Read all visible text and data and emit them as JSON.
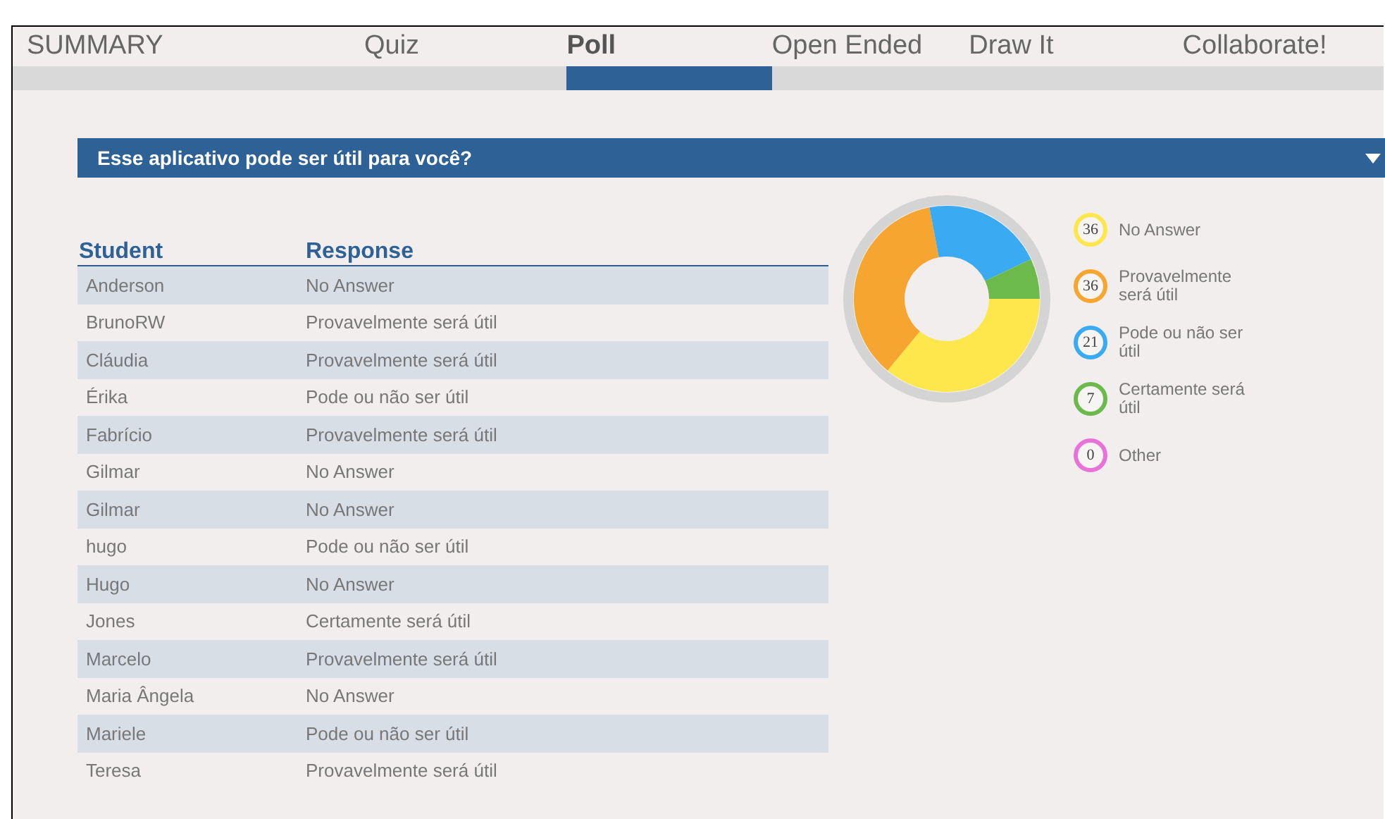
{
  "tabs": [
    {
      "label": "SUMMARY",
      "selected": false
    },
    {
      "label": "Quiz",
      "selected": false
    },
    {
      "label": "Poll",
      "selected": true
    },
    {
      "label": "Open Ended",
      "selected": false
    },
    {
      "label": "Draw It",
      "selected": false
    },
    {
      "label": "Collaborate!",
      "selected": false
    }
  ],
  "question": {
    "title": "Esse aplicativo pode ser útil para você?",
    "expanded": true
  },
  "table": {
    "columns": [
      "Student",
      "Response"
    ],
    "rows": [
      [
        "Anderson",
        "No Answer"
      ],
      [
        "BrunoRW",
        "Provavelmente será útil"
      ],
      [
        "Cláudia",
        "Provavelmente será útil"
      ],
      [
        "Érika",
        "Pode ou não ser útil"
      ],
      [
        "Fabrício",
        "Provavelmente será útil"
      ],
      [
        "Gilmar",
        "No Answer"
      ],
      [
        "Gilmar",
        "No Answer"
      ],
      [
        "hugo",
        "Pode ou não ser útil"
      ],
      [
        "Hugo",
        "No Answer"
      ],
      [
        "Jones",
        "Certamente será útil"
      ],
      [
        "Marcelo",
        "Provavelmente será útil"
      ],
      [
        "Maria Ângela",
        "No Answer"
      ],
      [
        "Mariele",
        "Pode ou não ser útil"
      ],
      [
        "Teresa",
        "Provavelmente será útil"
      ]
    ]
  },
  "chart_data": {
    "type": "donut",
    "categories": [
      "No Answer",
      "Provavelmente será útil",
      "Pode ou não ser útil",
      "Certamente será útil",
      "Other"
    ],
    "values": [
      36,
      36,
      21,
      7,
      0
    ]
  },
  "legend": [
    {
      "count": "36",
      "color": "#fde74c"
    },
    {
      "count": "36",
      "color": "#f7a531"
    },
    {
      "count": "21",
      "color": "#3aabf3"
    },
    {
      "count": "7",
      "color": "#6dba4c"
    },
    {
      "count": "0",
      "color": "#e872d8"
    }
  ]
}
